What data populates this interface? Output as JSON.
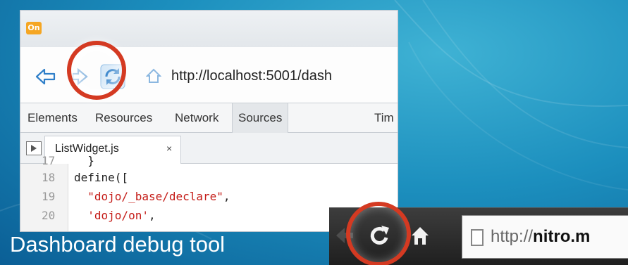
{
  "app_icon": {
    "label": "On",
    "color": "#f5a623"
  },
  "nav": {
    "url": "http://localhost:5001/dash",
    "reload_color": "#3b8fd8"
  },
  "devtools": {
    "tabs": [
      "Elements",
      "Resources",
      "Network",
      "Sources",
      "Tim"
    ],
    "active_tab": "Sources",
    "file_tab": {
      "name": "ListWidget.js",
      "close": "×"
    }
  },
  "code": {
    "lines": [
      {
        "num": "17",
        "pre": "  }",
        "str": "",
        "post": ""
      },
      {
        "num": "18",
        "pre": "define([",
        "str": "",
        "post": ""
      },
      {
        "num": "19",
        "pre": "  ",
        "str": "\"dojo/_base/declare\"",
        "post": ","
      },
      {
        "num": "20",
        "pre": "  ",
        "str": "'dojo/on'",
        "post": ","
      }
    ]
  },
  "caption": "Dashboard debug tool",
  "browser": {
    "url_host": "http://",
    "url_bold": "nitro.m"
  },
  "highlight_color": "#d43a22"
}
